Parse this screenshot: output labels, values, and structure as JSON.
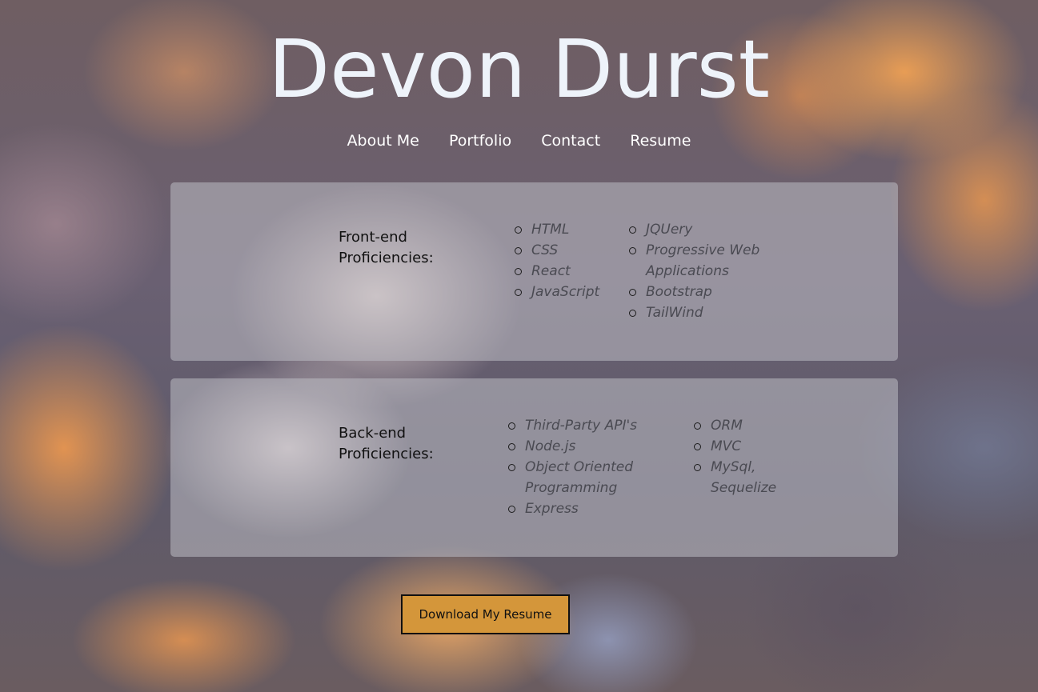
{
  "header": {
    "title": "Devon Durst"
  },
  "nav": {
    "items": [
      {
        "label": "About Me"
      },
      {
        "label": "Portfolio"
      },
      {
        "label": "Contact"
      },
      {
        "label": "Resume"
      }
    ]
  },
  "frontend": {
    "label": "Front-end Proficiencies:",
    "col1": [
      "HTML",
      "CSS",
      "React",
      "JavaScript"
    ],
    "col2": [
      "JQUery",
      "Progressive Web Applications",
      "Bootstrap",
      "TailWind"
    ]
  },
  "backend": {
    "label": "Back-end Proficiencies:",
    "col1": [
      "Third-Party API's",
      "Node.js",
      "Object Oriented Programming",
      "Express"
    ],
    "col2": [
      "ORM",
      "MVC",
      "MySql, Sequelize"
    ]
  },
  "download": {
    "label": "Download My Resume"
  },
  "colors": {
    "title": "#eef3fa",
    "button": "#d4963a",
    "card": "#bebec4"
  }
}
